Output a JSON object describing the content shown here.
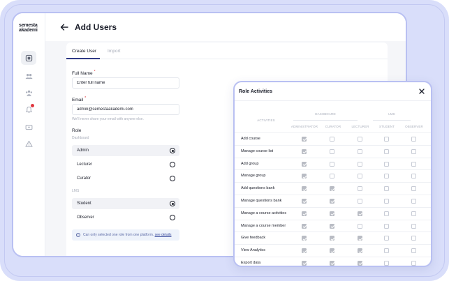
{
  "brand": {
    "line1": "semesta",
    "line2": "akademi"
  },
  "sidebar": {
    "items": [
      {
        "icon": "dashboard-icon",
        "active": true
      },
      {
        "icon": "users-icon",
        "active": false
      },
      {
        "icon": "groups-icon",
        "active": false
      },
      {
        "icon": "bell-icon",
        "active": false,
        "badge": true
      },
      {
        "icon": "card-icon",
        "active": false
      },
      {
        "icon": "warning-icon",
        "active": false
      }
    ]
  },
  "header": {
    "title": "Add Users"
  },
  "tabs": [
    {
      "label": "Create User"
    },
    {
      "label": "Import"
    }
  ],
  "form": {
    "full_name": {
      "label": "Full Name",
      "required": "*",
      "placeholder": "Enter full name"
    },
    "email": {
      "label": "Email",
      "required": "*",
      "value": "admin@semestaakademi.com",
      "hint": "We'll never share your email with anyone else."
    },
    "role": {
      "label": "Role",
      "groups": [
        {
          "name": "Dashboard",
          "options": [
            {
              "label": "Admin",
              "selected": true
            },
            {
              "label": "Lecturer",
              "selected": false
            },
            {
              "label": "Curator",
              "selected": false
            }
          ]
        },
        {
          "name": "LMS",
          "options": [
            {
              "label": "Student",
              "selected": true
            },
            {
              "label": "Observer",
              "selected": false
            }
          ]
        }
      ]
    },
    "info": {
      "text": "Can only selected one role from one platform.",
      "link": "see details"
    }
  },
  "modal": {
    "title": "Role Activities",
    "activities_header": "ACTIVITIES",
    "groups": [
      {
        "name": "DASHBOARD"
      },
      {
        "name": "LMS"
      }
    ],
    "columns": [
      "ADMINISTRATOR",
      "CURATOR",
      "LECTURER",
      "STUDENT",
      "OBSERVER"
    ],
    "rows": [
      {
        "name": "Add course",
        "checks": [
          true,
          false,
          false,
          false,
          false
        ]
      },
      {
        "name": "Manage course list",
        "checks": [
          true,
          false,
          false,
          false,
          false
        ]
      },
      {
        "name": "Add group",
        "checks": [
          true,
          false,
          false,
          false,
          false
        ]
      },
      {
        "name": "Manage group",
        "checks": [
          true,
          false,
          false,
          false,
          false
        ]
      },
      {
        "name": "Add questions bank",
        "checks": [
          true,
          true,
          false,
          false,
          false
        ]
      },
      {
        "name": "Manage questions bank",
        "checks": [
          true,
          true,
          false,
          false,
          false
        ]
      },
      {
        "name": "Manage a course activities",
        "checks": [
          true,
          true,
          true,
          false,
          false
        ]
      },
      {
        "name": "Manage a course member",
        "checks": [
          true,
          true,
          false,
          false,
          false
        ]
      },
      {
        "name": "Give feedback",
        "checks": [
          true,
          true,
          true,
          false,
          false
        ]
      },
      {
        "name": "View Analytics",
        "checks": [
          true,
          true,
          true,
          false,
          false
        ]
      },
      {
        "name": "Export data",
        "checks": [
          true,
          true,
          true,
          false,
          false
        ]
      }
    ]
  }
}
